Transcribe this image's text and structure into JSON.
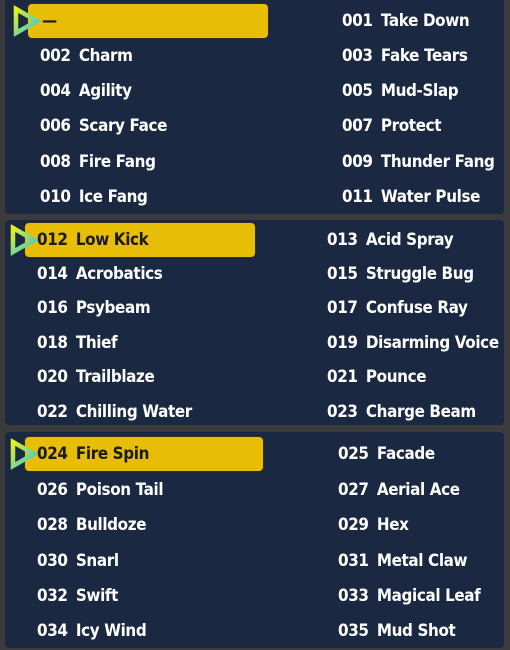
{
  "colors": {
    "background": "#3b3b3d",
    "panel": "#1b2842",
    "highlight": "#e8bd06",
    "text": "#ffffff",
    "highlight_text": "#1a1a1a"
  },
  "cursor_icon": "triangle-cursor-icon",
  "panels": [
    {
      "selected": {
        "number": "",
        "name": "—"
      },
      "left": [
        {
          "number": "002",
          "name": "Charm"
        },
        {
          "number": "004",
          "name": "Agility"
        },
        {
          "number": "006",
          "name": "Scary Face"
        },
        {
          "number": "008",
          "name": "Fire Fang"
        },
        {
          "number": "010",
          "name": "Ice Fang"
        }
      ],
      "right": [
        {
          "number": "001",
          "name": "Take Down"
        },
        {
          "number": "003",
          "name": "Fake Tears"
        },
        {
          "number": "005",
          "name": "Mud-Slap"
        },
        {
          "number": "007",
          "name": "Protect"
        },
        {
          "number": "009",
          "name": "Thunder Fang"
        },
        {
          "number": "011",
          "name": "Water Pulse"
        }
      ]
    },
    {
      "selected": {
        "number": "012",
        "name": "Low Kick"
      },
      "left": [
        {
          "number": "014",
          "name": "Acrobatics"
        },
        {
          "number": "016",
          "name": "Psybeam"
        },
        {
          "number": "018",
          "name": "Thief"
        },
        {
          "number": "020",
          "name": "Trailblaze"
        },
        {
          "number": "022",
          "name": "Chilling Water"
        }
      ],
      "right": [
        {
          "number": "013",
          "name": "Acid Spray"
        },
        {
          "number": "015",
          "name": "Struggle Bug"
        },
        {
          "number": "017",
          "name": "Confuse Ray"
        },
        {
          "number": "019",
          "name": "Disarming Voice"
        },
        {
          "number": "021",
          "name": "Pounce"
        },
        {
          "number": "023",
          "name": "Charge Beam"
        }
      ]
    },
    {
      "selected": {
        "number": "024",
        "name": "Fire Spin"
      },
      "left": [
        {
          "number": "026",
          "name": "Poison Tail"
        },
        {
          "number": "028",
          "name": "Bulldoze"
        },
        {
          "number": "030",
          "name": "Snarl"
        },
        {
          "number": "032",
          "name": "Swift"
        },
        {
          "number": "034",
          "name": "Icy Wind"
        }
      ],
      "right": [
        {
          "number": "025",
          "name": "Facade"
        },
        {
          "number": "027",
          "name": "Aerial Ace"
        },
        {
          "number": "029",
          "name": "Hex"
        },
        {
          "number": "031",
          "name": "Metal Claw"
        },
        {
          "number": "033",
          "name": "Magical Leaf"
        },
        {
          "number": "035",
          "name": "Mud Shot"
        }
      ]
    }
  ]
}
